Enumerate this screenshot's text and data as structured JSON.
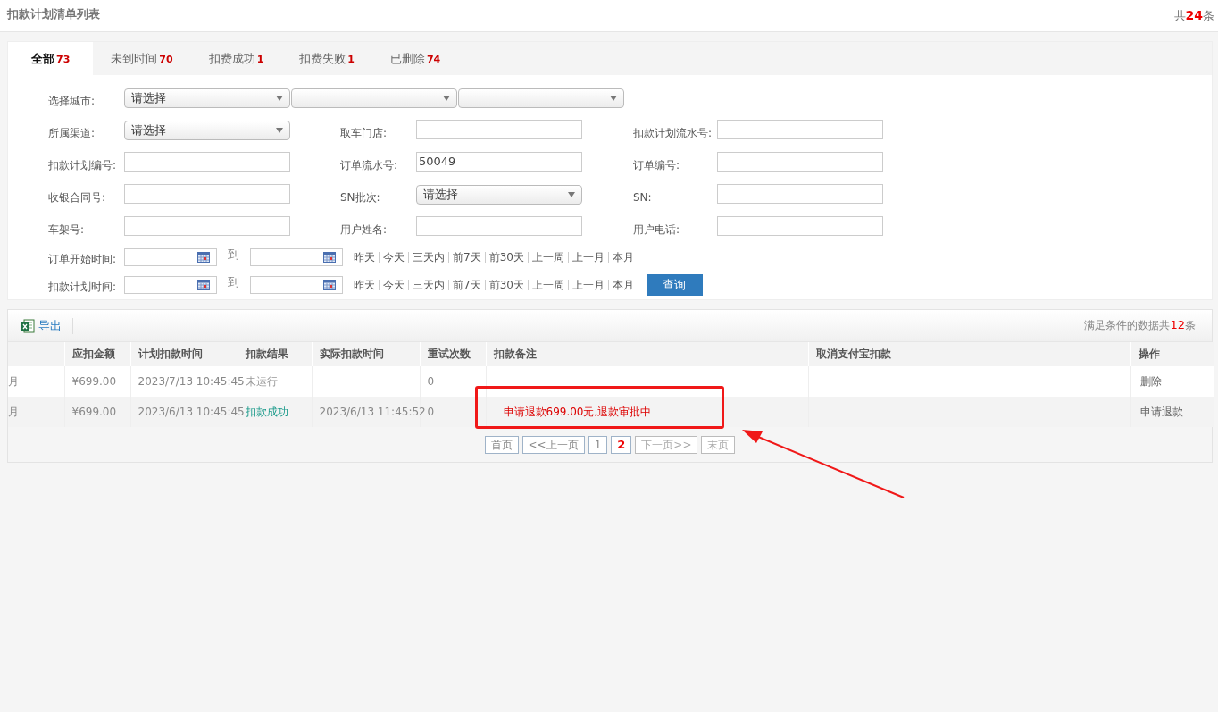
{
  "header": {
    "title": "扣款计划清单列表",
    "total_prefix": "共",
    "total_count": "24",
    "total_suffix": "条"
  },
  "tabs": [
    {
      "label": "全部",
      "count": "73",
      "selected": true
    },
    {
      "label": "未到时间",
      "count": "70",
      "selected": false
    },
    {
      "label": "扣费成功",
      "count": "1",
      "selected": false
    },
    {
      "label": "扣费失败",
      "count": "1",
      "selected": false
    },
    {
      "label": "已删除",
      "count": "74",
      "selected": false
    }
  ],
  "filters": {
    "city": {
      "label": "选择城市:",
      "selects": [
        {
          "kind": "filled",
          "value": "请选择"
        },
        {
          "kind": "blank"
        },
        {
          "kind": "blank"
        }
      ]
    },
    "rows": [
      [
        {
          "label": "所属渠道:",
          "kind": "select",
          "value": "请选择"
        },
        {
          "label": "取车门店:",
          "kind": "input"
        },
        {
          "label": "扣款计划流水号:",
          "kind": "input"
        }
      ],
      [
        {
          "label": "扣款计划编号:",
          "kind": "input"
        },
        {
          "label": "订单流水号:",
          "kind": "input",
          "value": "50049"
        },
        {
          "label": "订单编号:",
          "kind": "input"
        }
      ],
      [
        {
          "label": "收银合同号:",
          "kind": "input"
        },
        {
          "label": "SN批次:",
          "kind": "select",
          "value": "请选择"
        },
        {
          "label": "SN:",
          "kind": "input"
        }
      ],
      [
        {
          "label": "车架号:",
          "kind": "input"
        },
        {
          "label": "用户姓名:",
          "kind": "input"
        },
        {
          "label": "用户电话:",
          "kind": "input"
        }
      ]
    ],
    "date_rows": [
      {
        "label": "订单开始时间:",
        "to": "到",
        "quick": [
          "昨天",
          "今天",
          "三天内",
          "前7天",
          "前30天",
          "上一周",
          "上一月",
          "本月"
        ]
      },
      {
        "label": "扣款计划时间:",
        "to": "到",
        "quick": [
          "昨天",
          "今天",
          "三天内",
          "前7天",
          "前30天",
          "上一周",
          "上一月",
          "本月"
        ],
        "button": "查询"
      }
    ]
  },
  "toolbar": {
    "export": "导出",
    "summary_prefix": "满足条件的数据共",
    "summary_count": "12",
    "summary_suffix": "条"
  },
  "table": {
    "columns": [
      "",
      "应扣金额",
      "计划扣款时间",
      "扣款结果",
      "实际扣款时间",
      "重试次数",
      "扣款备注",
      "取消支付宝扣款",
      "操作"
    ],
    "rows": [
      {
        "column_1": "月",
        "amount": "¥699.00",
        "planned_time": "2023/7/13 10:45:45",
        "result": {
          "text": "未运行",
          "color": "#999999"
        },
        "retries": "0",
        "action": "删除",
        "highlighted": false
      },
      {
        "column_1": "月",
        "amount": "¥699.00",
        "planned_time": "2023/6/13 10:45:45",
        "result": {
          "text": "扣款成功",
          "color": "#1a9a8a"
        },
        "actual_time": "2023/6/13 11:45:52",
        "retries": "0",
        "remark": "申请退款699.00元,退款审批中",
        "action": "申请退款",
        "highlighted": true
      }
    ]
  },
  "pagination": [
    {
      "label": "首页",
      "selected": false,
      "disabled": false
    },
    {
      "label": "<<上一页",
      "selected": false,
      "disabled": false
    },
    {
      "label": "1",
      "selected": false,
      "disabled": false
    },
    {
      "label": "2",
      "selected": true,
      "disabled": false
    },
    {
      "label": "下一页>>",
      "selected": false,
      "disabled": true
    },
    {
      "label": "末页",
      "selected": false,
      "disabled": true
    }
  ]
}
